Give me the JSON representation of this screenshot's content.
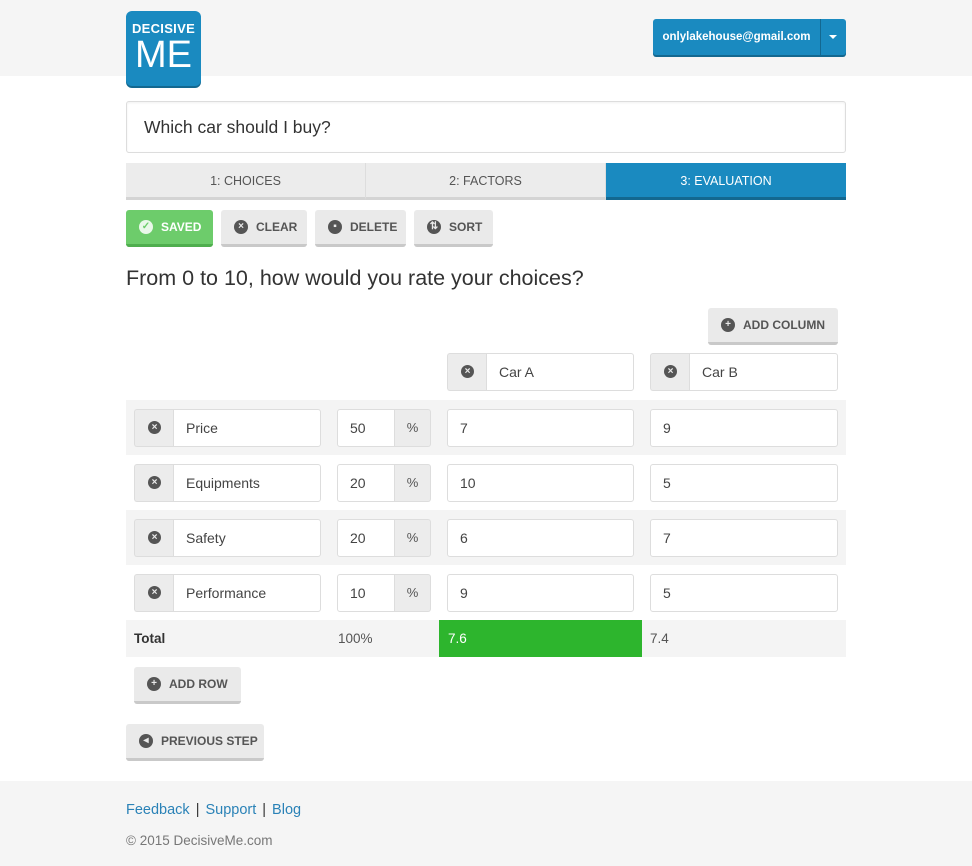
{
  "header": {
    "logo_line1": "DECISIVE",
    "logo_line2": "ME",
    "account_email": "onlylakehouse@gmail.com"
  },
  "question": "Which car should I buy?",
  "steps": [
    {
      "label": "1: CHOICES"
    },
    {
      "label": "2: FACTORS"
    },
    {
      "label": "3: EVALUATION",
      "active": true
    }
  ],
  "toolbar": {
    "saved": "SAVED",
    "clear": "CLEAR",
    "delete": "DELETE",
    "sort": "SORT"
  },
  "heading": "From 0 to 10, how would you rate your choices?",
  "add_column": "ADD COLUMN",
  "choices": [
    {
      "name": "Car A"
    },
    {
      "name": "Car B"
    }
  ],
  "factors": [
    {
      "name": "Price",
      "weight": "50",
      "unit": "%",
      "scores": [
        "7",
        "9"
      ]
    },
    {
      "name": "Equipments",
      "weight": "20",
      "unit": "%",
      "scores": [
        "10",
        "5"
      ]
    },
    {
      "name": "Safety",
      "weight": "20",
      "unit": "%",
      "scores": [
        "6",
        "7"
      ]
    },
    {
      "name": "Performance",
      "weight": "10",
      "unit": "%",
      "scores": [
        "9",
        "5"
      ]
    }
  ],
  "total": {
    "label": "Total",
    "weight": "100%",
    "scores": [
      "7.6",
      "7.4"
    ],
    "winner_color": "#2db52d"
  },
  "add_row": "ADD ROW",
  "previous_step": "PREVIOUS STEP",
  "footer": {
    "links": [
      "Feedback",
      "Support",
      "Blog"
    ],
    "separator": "|",
    "copyright": "© 2015 DecisiveMe.com"
  },
  "colors": {
    "primary": "#1a8ac0",
    "saved": "#6dcc6b"
  }
}
